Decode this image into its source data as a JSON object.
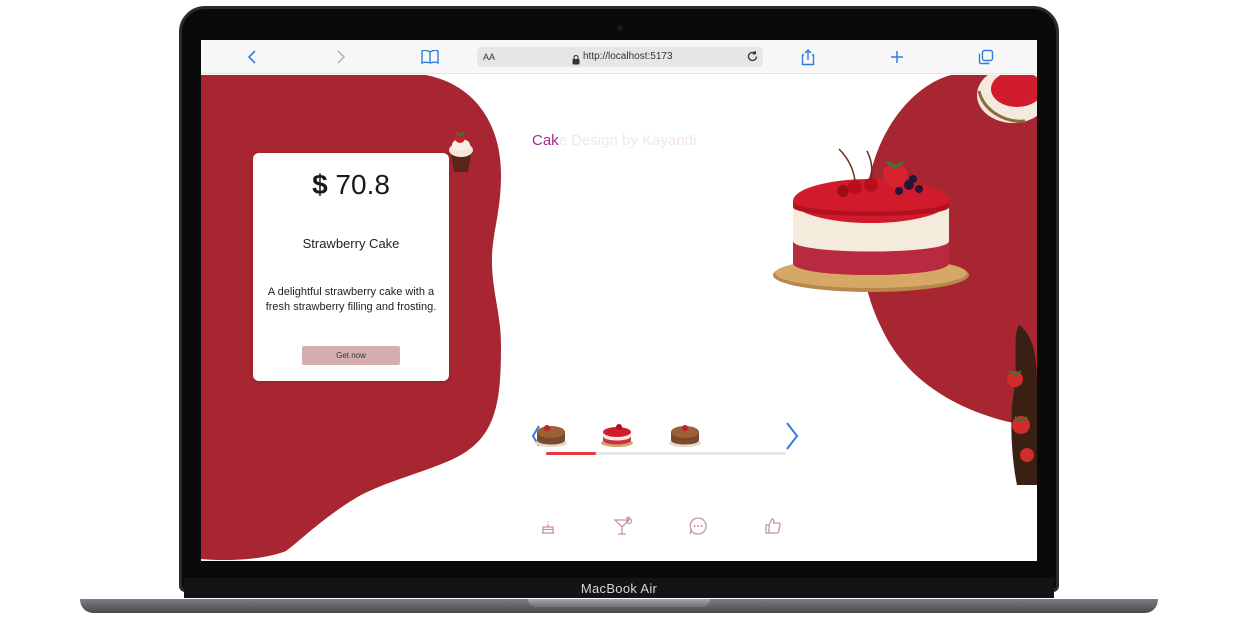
{
  "device": {
    "model_label": "MacBook Air"
  },
  "browser": {
    "text_size_label": "AA",
    "url": "http://localhost:5173",
    "icons": [
      "back-icon",
      "forward-icon",
      "bookmarks-icon",
      "lock-icon",
      "reload-icon",
      "share-icon",
      "new-tab-icon",
      "tabs-icon"
    ]
  },
  "page": {
    "headline_a": "Cak",
    "headline_b": "e Design by Kayandi",
    "card": {
      "currency": "$",
      "price": "70.8",
      "title": "Strawberry Cake",
      "description": "A delightful strawberry cake with a fresh strawberry filling and frosting.",
      "button": "Get now"
    },
    "carousel": {
      "progress": 0.21,
      "thumbnails": [
        "chocolate-cake",
        "strawberry-cake",
        "chocolate-cake"
      ]
    },
    "bottom_nav_icons": [
      "cake-icon",
      "cocktail-icon",
      "chat-icon",
      "thumbs-up-icon"
    ],
    "colors": {
      "brand_red": "#a82631",
      "button": "#d4aeb1",
      "progress": "#e8383e",
      "headline": "#a12c8c"
    }
  }
}
